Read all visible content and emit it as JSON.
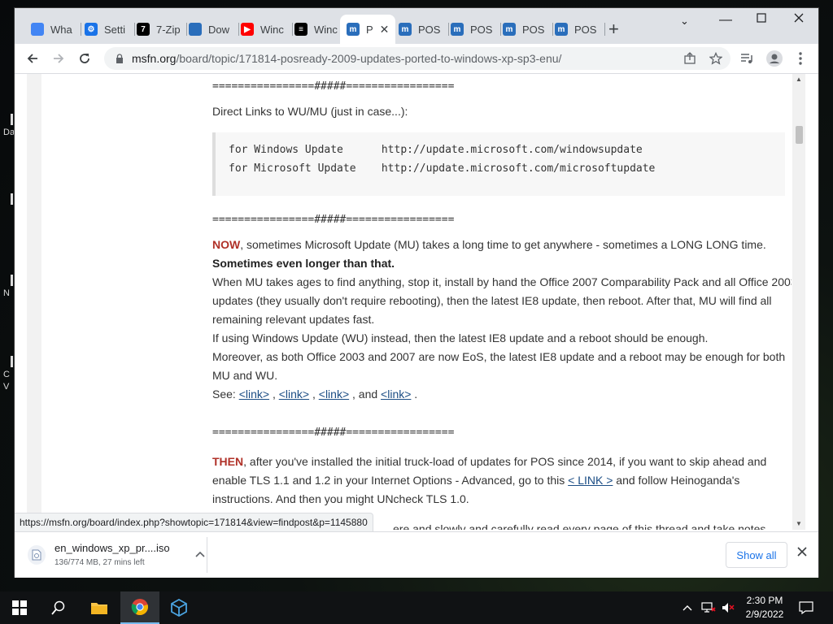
{
  "desktop": {
    "fragments": [
      "Da",
      "N",
      "C",
      "V"
    ]
  },
  "browser": {
    "tabs": [
      {
        "label": "Wha",
        "icon": "chrome-icon",
        "color": "#4285f4"
      },
      {
        "label": "Setti",
        "icon": "gear-icon",
        "color": "#1a73e8"
      },
      {
        "label": "7-Zip",
        "icon": "sevenzip-icon",
        "color": "#000000"
      },
      {
        "label": "Dow",
        "icon": "download-page-icon",
        "color": "#2a6ebb"
      },
      {
        "label": "Winc",
        "icon": "youtube-icon",
        "color": "#ff0000"
      },
      {
        "label": "Winc",
        "icon": "archive-icon",
        "color": "#000000"
      },
      {
        "label": "P",
        "icon": "msfn-icon",
        "color": "#2a6ebb",
        "active": true
      },
      {
        "label": "POS",
        "icon": "msfn-icon",
        "color": "#2a6ebb"
      },
      {
        "label": "POS",
        "icon": "msfn-icon",
        "color": "#2a6ebb"
      },
      {
        "label": "POS",
        "icon": "msfn-icon",
        "color": "#2a6ebb"
      },
      {
        "label": "POS",
        "icon": "msfn-icon",
        "color": "#2a6ebb"
      }
    ],
    "url_host": "msfn.org",
    "url_path": "/board/topic/171814-posready-2009-updates-ported-to-windows-xp-sp3-enu/",
    "status_url": "https://msfn.org/board/index.php?showtopic=171814&view=findpost&p=1145880"
  },
  "post": {
    "separator": "================#####=================",
    "direct_links_heading": "Direct Links to WU/MU (just in case...):",
    "code_lines": [
      "for Windows Update      http://update.microsoft.com/windowsupdate",
      "for Microsoft Update    http://update.microsoft.com/microsoftupdate"
    ],
    "now_label": "NOW",
    "now_text": ", sometimes Microsoft Update (MU) takes a long time to get anywhere - sometimes a LONG LONG time.",
    "bold_line": "Sometimes even longer than that.",
    "p1": "When MU takes ages to find anything, stop it, install by hand the Office 2007 Comparability Pack and all Office 2003 updates (they usually don't require rebooting), then the latest IE8 update, then reboot.   After that, MU will find all remaining relevant updates fast.",
    "p2": "If using Windows Update (WU) instead, then the latest IE8 update and a reboot should be enough.",
    "p3": "Moreover, as both Office 2003 and 2007 are now EoS, the latest IE8 update and a reboot may be enough for both MU and WU.",
    "see_label": "See:",
    "links": [
      "<link>",
      "<link>",
      "<link>",
      "<link>"
    ],
    "and_word": "and",
    "then_label": "THEN",
    "then_text": ", after you've installed the initial truck-load of updates for POS since 2014, if you want to skip ahead and enable TLS 1.1 and 1.2 in your Internet Options - Advanced, go to this ",
    "then_link": "< LINK >",
    "then_text2": " and follow Heinoganda's instructions.  And then you might UNcheck TLS 1.0.",
    "last_line_fragment": "ere and slowly and carefully read every page of this thread and take notes"
  },
  "downloads": {
    "file_name": "en_windows_xp_pr....iso",
    "progress": "136/774 MB, 27 mins left",
    "show_all": "Show all"
  },
  "taskbar": {
    "time": "2:30 PM",
    "date": "2/9/2022"
  }
}
